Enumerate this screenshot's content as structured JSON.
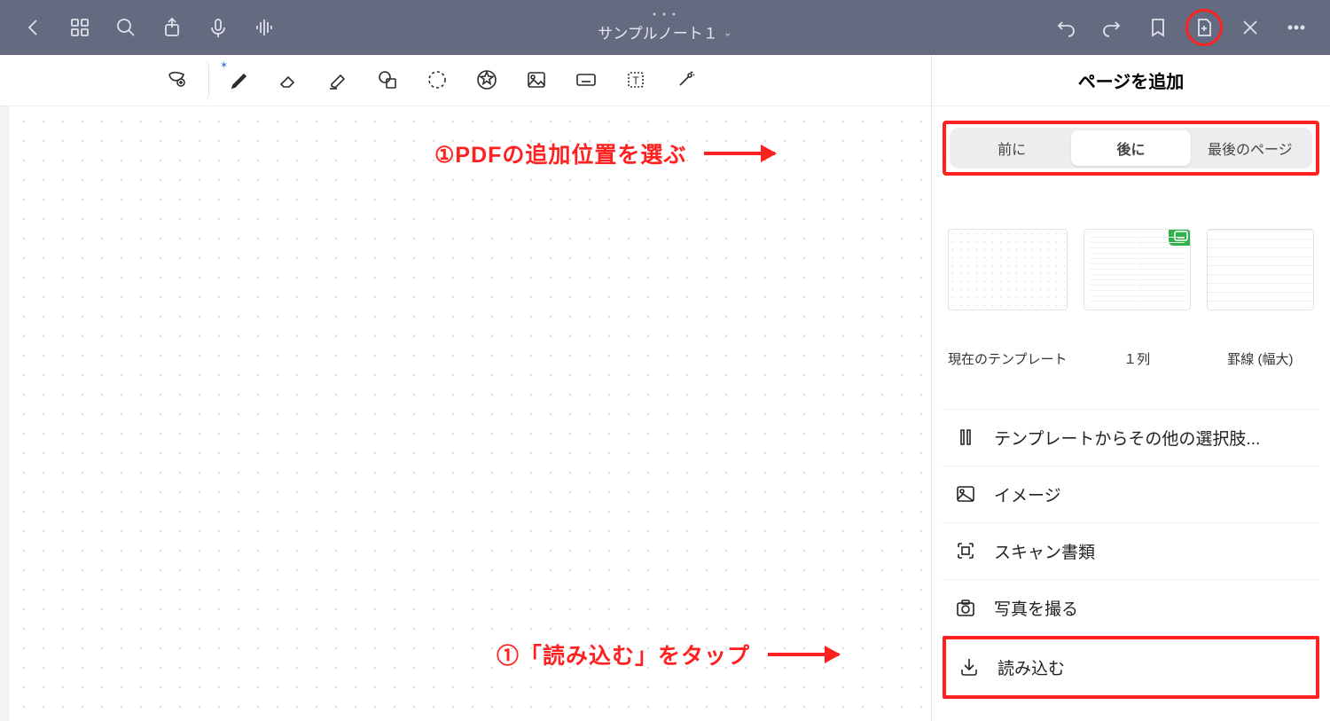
{
  "titlebar": {
    "doc_title": "サンプルノート１"
  },
  "panel": {
    "title": "ページを追加",
    "segments": {
      "before": "前に",
      "after": "後に",
      "last": "最後のページ"
    },
    "templates": {
      "current": "現在のテンプレート",
      "one_col": "１列",
      "ruled_large": "罫線 (幅大)"
    },
    "menu": {
      "more_templates": "テンプレートからその他の選択肢...",
      "image": "イメージ",
      "scan": "スキャン書類",
      "take_photo": "写真を撮る",
      "import": "読み込む"
    }
  },
  "annotations": {
    "step1a": "①PDFの追加位置を選ぶ",
    "step1b": "①「読み込む」をタップ"
  }
}
